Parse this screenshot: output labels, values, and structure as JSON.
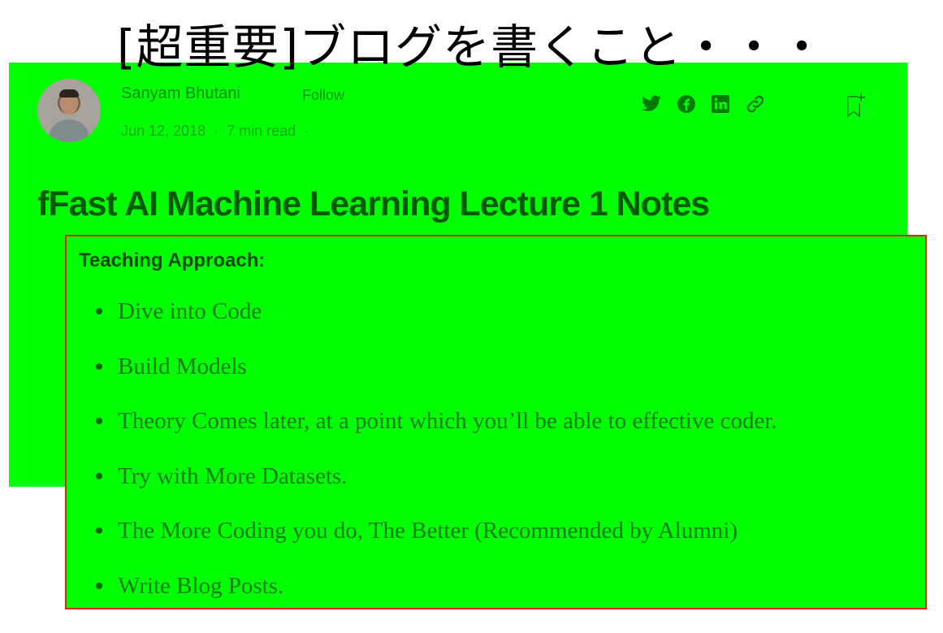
{
  "slide": {
    "title": "[超重要]ブログを書くこと・・・"
  },
  "article": {
    "author": "Sanyam Bhutani",
    "follow_label": "Follow",
    "date": "Jun 12, 2018",
    "read_time": "7 min read",
    "meta_separator": "·",
    "title": "fFast AI Machine Learning Lecture 1 Notes",
    "share_icons": [
      "twitter-icon",
      "facebook-icon",
      "linkedin-icon",
      "link-icon"
    ],
    "bookmark_icon": "bookmark-add-icon"
  },
  "notes": {
    "heading": "Teaching Approach:",
    "items": [
      "Dive into Code",
      "Build Models",
      "Theory Comes later, at a point which you’ll be able to effective coder.",
      "Try with More Datasets.",
      "The More Coding you do, The Better (Recommended by Alumni)",
      "Write Blog Posts."
    ]
  },
  "colors": {
    "highlight_green": "#00ff00",
    "box_border": "#e0231c"
  }
}
